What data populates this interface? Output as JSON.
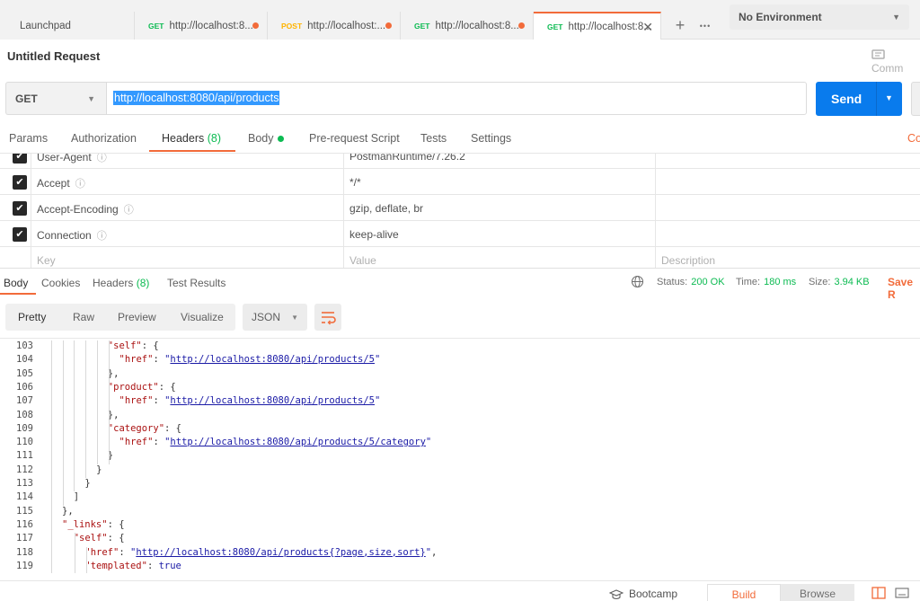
{
  "tabs": [
    {
      "method": "",
      "label": "Launchpad",
      "dirty": false,
      "active": false
    },
    {
      "method": "GET",
      "label": "http://localhost:8...",
      "dirty": true,
      "active": false
    },
    {
      "method": "POST",
      "label": "http://localhost:...",
      "dirty": true,
      "active": false
    },
    {
      "method": "GET",
      "label": "http://localhost:8...",
      "dirty": true,
      "active": false
    },
    {
      "method": "GET",
      "label": "http://localhost:8...",
      "dirty": false,
      "active": true
    }
  ],
  "tabbar": {
    "add": "+",
    "more": "•••"
  },
  "environment": {
    "selected": "No Environment"
  },
  "request": {
    "title": "Untitled Request",
    "comments_label": "Comm",
    "method": "GET",
    "url": "http://localhost:8080/api/products",
    "send_label": "Send"
  },
  "request_tabs": {
    "params": "Params",
    "authorization": "Authorization",
    "headers": "Headers",
    "headers_count": "(8)",
    "body": "Body",
    "prerequest": "Pre-request Script",
    "tests": "Tests",
    "settings": "Settings",
    "cookies": "Co"
  },
  "headers": [
    {
      "key": "User-Agent",
      "value": "PostmanRuntime/7.26.2"
    },
    {
      "key": "Accept",
      "value": "*/*"
    },
    {
      "key": "Accept-Encoding",
      "value": "gzip, deflate, br"
    },
    {
      "key": "Connection",
      "value": "keep-alive"
    }
  ],
  "headers_placeholder": {
    "key": "Key",
    "value": "Value",
    "description": "Description"
  },
  "response_tabs": {
    "body": "Body",
    "cookies": "Cookies",
    "headers": "Headers",
    "headers_count": "(8)",
    "test_results": "Test Results"
  },
  "response_status": {
    "status_label": "Status:",
    "status": "200 OK",
    "time_label": "Time:",
    "time": "180 ms",
    "size_label": "Size:",
    "size": "3.94 KB",
    "save": "Save R"
  },
  "view_modes": {
    "pretty": "Pretty",
    "raw": "Raw",
    "preview": "Preview",
    "visualize": "Visualize",
    "format": "JSON"
  },
  "code_lines": [
    {
      "n": "103",
      "indent": 8,
      "parts": [
        [
          "k",
          "\"self\""
        ],
        [
          "p",
          ": {"
        ]
      ]
    },
    {
      "n": "104",
      "indent": 10,
      "parts": [
        [
          "k",
          "\"href\""
        ],
        [
          "p",
          ": "
        ],
        [
          "s",
          "\""
        ],
        [
          "l",
          "http://localhost:8080/api/products/5"
        ],
        [
          "s",
          "\""
        ]
      ]
    },
    {
      "n": "105",
      "indent": 8,
      "parts": [
        [
          "p",
          "},"
        ]
      ]
    },
    {
      "n": "106",
      "indent": 8,
      "parts": [
        [
          "k",
          "\"product\""
        ],
        [
          "p",
          ": {"
        ]
      ]
    },
    {
      "n": "107",
      "indent": 10,
      "parts": [
        [
          "k",
          "\"href\""
        ],
        [
          "p",
          ": "
        ],
        [
          "s",
          "\""
        ],
        [
          "l",
          "http://localhost:8080/api/products/5"
        ],
        [
          "s",
          "\""
        ]
      ]
    },
    {
      "n": "108",
      "indent": 8,
      "parts": [
        [
          "p",
          "},"
        ]
      ]
    },
    {
      "n": "109",
      "indent": 8,
      "parts": [
        [
          "k",
          "\"category\""
        ],
        [
          "p",
          ": {"
        ]
      ]
    },
    {
      "n": "110",
      "indent": 10,
      "parts": [
        [
          "k",
          "\"href\""
        ],
        [
          "p",
          ": "
        ],
        [
          "s",
          "\""
        ],
        [
          "l",
          "http://localhost:8080/api/products/5/category"
        ],
        [
          "s",
          "\""
        ]
      ]
    },
    {
      "n": "111",
      "indent": 8,
      "parts": [
        [
          "p",
          "}"
        ]
      ]
    },
    {
      "n": "112",
      "indent": 6,
      "parts": [
        [
          "p",
          "}"
        ]
      ]
    },
    {
      "n": "113",
      "indent": 4,
      "parts": [
        [
          "p",
          "}"
        ]
      ]
    },
    {
      "n": "114",
      "indent": 2,
      "parts": [
        [
          "p",
          "]"
        ]
      ]
    },
    {
      "n": "115",
      "indent": 0,
      "parts": [
        [
          "p",
          "},"
        ]
      ]
    },
    {
      "n": "116",
      "indent": 0,
      "parts": [
        [
          "k",
          "\"_links\""
        ],
        [
          "p",
          ": {"
        ]
      ]
    },
    {
      "n": "117",
      "indent": 2,
      "parts": [
        [
          "k",
          "\"self\""
        ],
        [
          "p",
          ": {"
        ]
      ]
    },
    {
      "n": "118",
      "indent": 4,
      "parts": [
        [
          "k",
          "\"href\""
        ],
        [
          "p",
          ": "
        ],
        [
          "s",
          "\""
        ],
        [
          "l",
          "http://localhost:8080/api/products{?page,size,sort}"
        ],
        [
          "s",
          "\""
        ],
        [
          "p",
          ","
        ]
      ]
    },
    {
      "n": "119",
      "indent": 4,
      "parts": [
        [
          "k",
          "\"templated\""
        ],
        [
          "p",
          ": "
        ],
        [
          "b",
          "true"
        ]
      ]
    }
  ],
  "footer": {
    "bootcamp": "Bootcamp",
    "build": "Build",
    "browse": "Browse"
  }
}
